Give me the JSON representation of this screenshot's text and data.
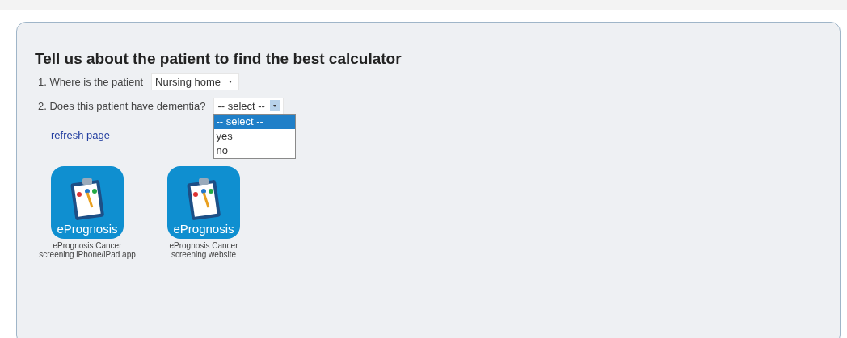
{
  "heading": "Tell us about the patient to find the best calculator",
  "questions": [
    {
      "number": "1.",
      "label": "Where is the patient",
      "value": "Nursing home",
      "open": false
    },
    {
      "number": "2.",
      "label": "Does this patient have dementia?",
      "value": "-- select --",
      "open": true,
      "options": [
        {
          "label": "-- select --",
          "selected": true
        },
        {
          "label": "yes",
          "selected": false
        },
        {
          "label": "no",
          "selected": false
        }
      ]
    }
  ],
  "refresh_link": "refresh page",
  "apps": [
    {
      "logo_text": "ePrognosis",
      "caption": "ePrognosis Cancer screening iPhone/iPad app"
    },
    {
      "logo_text": "ePrognosis",
      "caption": "ePrognosis Cancer screening website"
    }
  ]
}
